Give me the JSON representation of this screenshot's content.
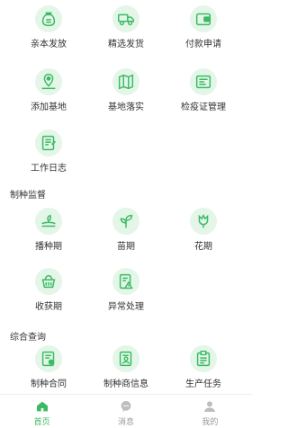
{
  "colors": {
    "accent": "#3cba63",
    "icon_bg": "#e3f6e8",
    "inactive": "#bdbdbd"
  },
  "top_grid": [
    {
      "label": "亲本发放",
      "icon": "seed-bag-icon"
    },
    {
      "label": "精选发货",
      "icon": "delivery-truck-icon"
    },
    {
      "label": "付款申请",
      "icon": "wallet-icon"
    },
    {
      "label": "添加基地",
      "icon": "location-pin-icon"
    },
    {
      "label": "基地落实",
      "icon": "map-icon"
    },
    {
      "label": "检疫证管理",
      "icon": "certificate-icon"
    },
    {
      "label": "工作日志",
      "icon": "notebook-icon"
    }
  ],
  "sections": [
    {
      "title": "制种监督",
      "items": [
        {
          "label": "播种期",
          "icon": "sowing-icon"
        },
        {
          "label": "苗期",
          "icon": "seedling-icon"
        },
        {
          "label": "花期",
          "icon": "flower-icon"
        },
        {
          "label": "收获期",
          "icon": "harvest-basket-icon"
        },
        {
          "label": "异常处理",
          "icon": "warning-document-icon"
        }
      ]
    },
    {
      "title": "综合查询",
      "items": [
        {
          "label": "制种合同",
          "icon": "contract-icon"
        },
        {
          "label": "制种商信息",
          "icon": "supplier-info-icon"
        },
        {
          "label": "生产任务",
          "icon": "task-list-icon"
        }
      ]
    }
  ],
  "tabbar": [
    {
      "label": "首页",
      "icon": "home-icon",
      "active": true
    },
    {
      "label": "消息",
      "icon": "message-icon",
      "active": false
    },
    {
      "label": "我的",
      "icon": "profile-icon",
      "active": false
    }
  ]
}
